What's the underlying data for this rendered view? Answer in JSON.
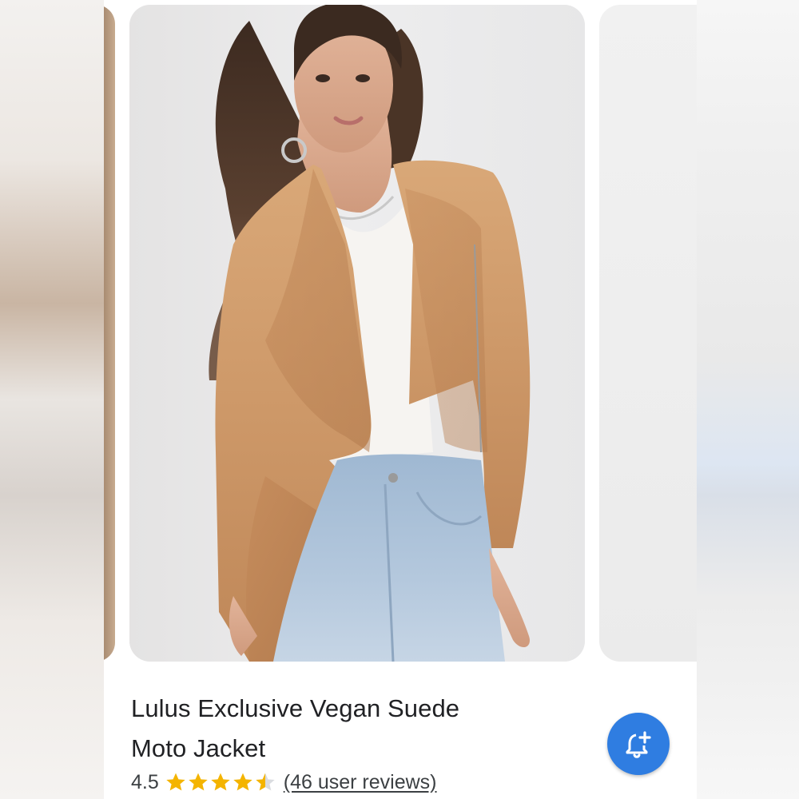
{
  "product": {
    "title_line1": "Lulus Exclusive Vegan Suede",
    "title_line2": "Moto Jacket",
    "rating_text": "4.5",
    "rating_value": 4.5,
    "rating_max": 5,
    "reviews_text": "(46 user reviews)"
  },
  "images": {
    "main_alt": "woman wearing tan vegan suede draped moto jacket with white top and light blue jeans"
  },
  "icons": {
    "fab": "add-alert-bell-icon",
    "star": "star-icon"
  },
  "colors": {
    "accent": "#2f7de1",
    "star": "#f4b400",
    "star_empty": "#dadce0",
    "title_text": "#202124"
  }
}
